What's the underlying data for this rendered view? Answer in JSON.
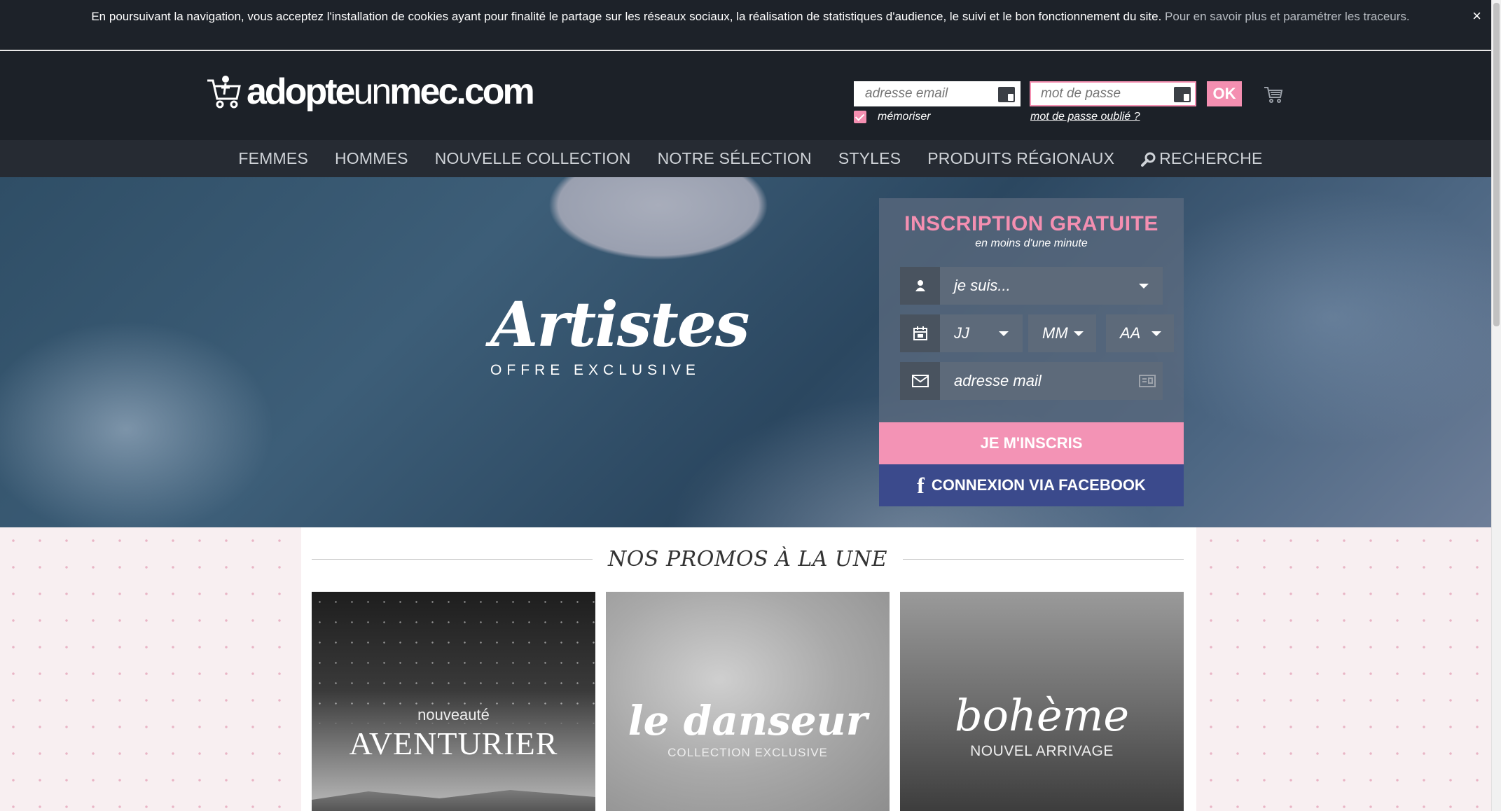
{
  "cookie": {
    "text": "En poursuivant la navigation, vous acceptez l'installation de cookies ayant pour finalité le partage sur les réseaux sociaux, la réalisation de statistiques d'audience, le suivi et le bon fonctionnement du site.",
    "more": "Pour en savoir plus et paramétrer les traceurs.",
    "close": "×"
  },
  "header": {
    "logo_main": "adopte",
    "logo_un": "un",
    "logo_end": "mec.com",
    "email_placeholder": "adresse email",
    "password_placeholder": "mot de passe",
    "ok_label": "OK",
    "remember_label": "mémoriser",
    "forgot_label": "mot de passe oublié ?"
  },
  "nav": {
    "items": [
      "FEMMES",
      "HOMMES",
      "NOUVELLE COLLECTION",
      "NOTRE SÉLECTION",
      "STYLES",
      "PRODUITS RÉGIONAUX",
      "RECHERCHE"
    ]
  },
  "hero": {
    "title": "Artistes",
    "subtitle": "OFFRE EXCLUSIVE"
  },
  "registration": {
    "title": "INSCRIPTION GRATUITE",
    "subtitle": "en moins d'une minute",
    "iam_placeholder": "je suis...",
    "day_placeholder": "JJ",
    "month_placeholder": "MM",
    "year_placeholder": "AA",
    "email_placeholder": "adresse mail",
    "submit_label": "JE M'INSCRIS",
    "facebook_label": "CONNEXION VIA FACEBOOK"
  },
  "promos": {
    "heading": "NOS PROMOS À LA UNE",
    "cards": [
      {
        "small": "nouveauté",
        "big": "AVENTURIER"
      },
      {
        "big": "le danseur",
        "small": "COLLECTION EXCLUSIVE"
      },
      {
        "big": "bohème",
        "small": "NOUVEL ARRIVAGE"
      }
    ]
  },
  "colors": {
    "accent_pink": "#f48fb1",
    "header_dark": "#1c2128",
    "facebook_blue": "#3b4a8c"
  }
}
